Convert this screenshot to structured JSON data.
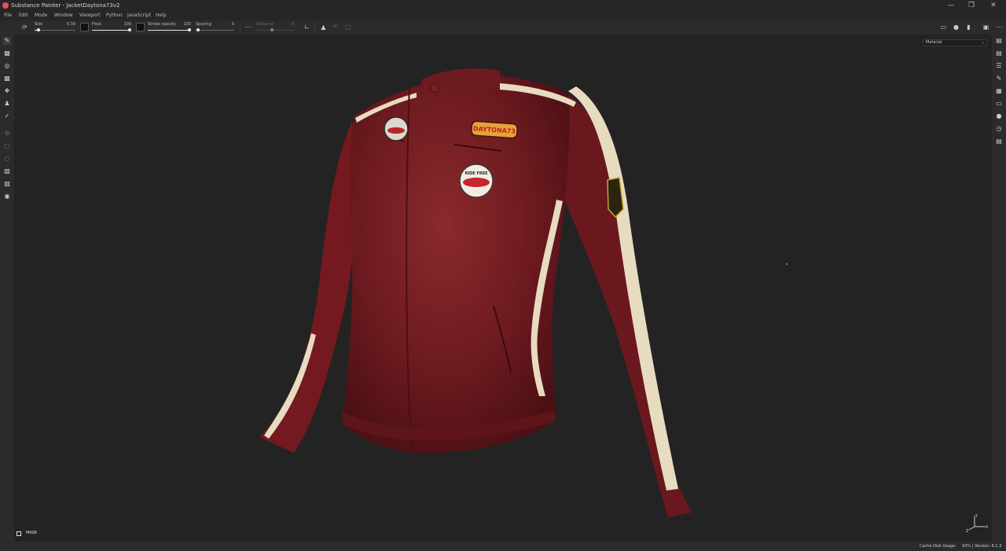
{
  "window": {
    "title": "Substance Painter - JacketDaytona73v2",
    "controls": [
      "minimize-icon",
      "maximize-icon",
      "close-icon"
    ]
  },
  "menu": [
    "File",
    "Edit",
    "Mode",
    "Window",
    "Viewport",
    "Python",
    "JavaScript",
    "Help"
  ],
  "toolbar": {
    "params": [
      {
        "label": "Size",
        "value": "0.39",
        "fill": 0.1,
        "enabled": true
      },
      {
        "label": "Flow",
        "value": "100",
        "fill": 1.0,
        "enabled": true
      },
      {
        "label": "Stroke opacity",
        "value": "100",
        "fill": 1.0,
        "enabled": true
      },
      {
        "label": "Spacing",
        "value": "5",
        "fill": 0.05,
        "enabled": true
      },
      {
        "label": "Distance",
        "value": "0",
        "fill": 0.4,
        "enabled": false
      }
    ]
  },
  "viewport": {
    "channel": "Material",
    "mask_label": "MASK",
    "patch_texts": [
      "DAYTONA73",
      "RIDE FREE"
    ],
    "colors": {
      "leather": "#7a1e22",
      "stripe": "#e9dcc0",
      "background": "#232323"
    }
  },
  "statusbar": {
    "cache_label": "Cache Disk Usage:",
    "cache_value": "93% | Version: 6.1.3"
  }
}
